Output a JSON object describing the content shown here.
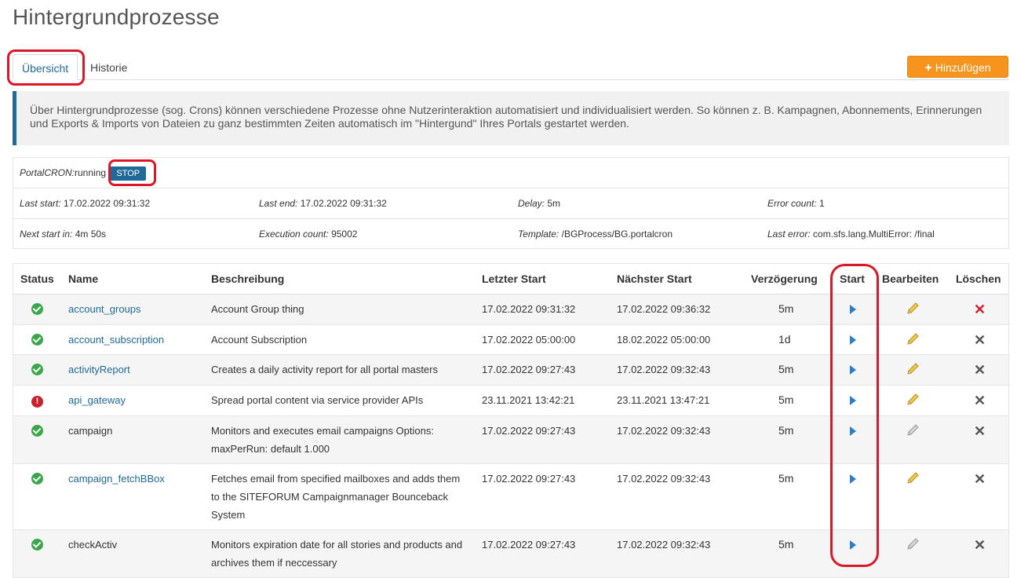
{
  "page": {
    "title": "Hintergrundprozesse"
  },
  "tabs": [
    {
      "label": "Übersicht"
    },
    {
      "label": "Historie"
    }
  ],
  "add_button": {
    "label": "Hinzufügen",
    "icon": "plus-icon"
  },
  "info_text": "Über Hintergrundprozesse (sog. Crons) können verschiedene Prozesse ohne Nutzerinteraktion automatisiert und individualisiert werden. So können z. B. Kampagnen, Abonnements, Erinnerungen und Exports & Imports von Dateien zu ganz bestimmten Zeiten automatisch im \"Hintergund\" Ihres Portals gestartet werden.",
  "cron": {
    "label": "PortalCRON:",
    "state": "running",
    "stop_label": "STOP",
    "last_start_label": "Last start:",
    "last_start": "17.02.2022 09:31:32",
    "last_end_label": "Last end:",
    "last_end": "17.02.2022 09:31:32",
    "delay_label": "Delay:",
    "delay": "5m",
    "error_count_label": "Error count:",
    "error_count": "1",
    "next_start_label": "Next start in:",
    "next_start": "4m 50s",
    "execution_count_label": "Execution count:",
    "execution_count": "95002",
    "template_label": "Template:",
    "template": "/BGProcess/BG.portalcron",
    "last_error_label": "Last error:",
    "last_error": "com.sfs.lang.MultiError: /final"
  },
  "table": {
    "headers": {
      "status": "Status",
      "name": "Name",
      "description": "Beschreibung",
      "last_start": "Letzter Start",
      "next_start": "Nächster Start",
      "delay": "Verzögerung",
      "start": "Start",
      "edit": "Bearbeiten",
      "delete": "Löschen"
    },
    "rows": [
      {
        "status": "ok",
        "name": "account_groups",
        "link": true,
        "description": "Account Group thing",
        "last_start": "17.02.2022 09:31:32",
        "next_start": "17.02.2022 09:36:32",
        "delay": "5m",
        "editable": true,
        "delete_color": "#c9202b"
      },
      {
        "status": "ok",
        "name": "account_subscription",
        "link": true,
        "description": "Account Subscription",
        "last_start": "17.02.2022 05:00:00",
        "next_start": "18.02.2022 05:00:00",
        "delay": "1d",
        "editable": true,
        "delete_color": "#555555"
      },
      {
        "status": "ok",
        "name": "activityReport",
        "link": true,
        "description": "Creates a daily activity report for all portal masters",
        "last_start": "17.02.2022 09:27:43",
        "next_start": "17.02.2022 09:32:43",
        "delay": "5m",
        "editable": true,
        "delete_color": "#555555"
      },
      {
        "status": "error",
        "name": "api_gateway",
        "link": true,
        "description": "Spread portal content via service provider APIs",
        "last_start": "23.11.2021 13:42:21",
        "next_start": "23.11.2021 13:47:21",
        "delay": "5m",
        "editable": true,
        "delete_color": "#555555"
      },
      {
        "status": "ok",
        "name": "campaign",
        "link": false,
        "description": "Monitors and executes email campaigns Options: maxPerRun: default 1.000",
        "last_start": "17.02.2022 09:27:43",
        "next_start": "17.02.2022 09:32:43",
        "delay": "5m",
        "editable": false,
        "delete_color": "#555555"
      },
      {
        "status": "ok",
        "name": "campaign_fetchBBox",
        "link": true,
        "description": "Fetches email from specified mailboxes and adds them to the SITEFORUM Campaignmanager Bounceback System",
        "last_start": "17.02.2022 09:27:43",
        "next_start": "17.02.2022 09:32:43",
        "delay": "5m",
        "editable": true,
        "delete_color": "#555555"
      },
      {
        "status": "ok",
        "name": "checkActiv",
        "link": false,
        "description": "Monitors expiration date for all stories and products and archives them if neccessary",
        "last_start": "17.02.2022 09:27:43",
        "next_start": "17.02.2022 09:32:43",
        "delay": "5m",
        "editable": false,
        "delete_color": "#555555"
      }
    ]
  },
  "colors": {
    "accent": "#1f6a98",
    "add_button": "#f7941d",
    "highlight": "#d9182a",
    "ok": "#3aa84a",
    "error": "#c9202b"
  }
}
